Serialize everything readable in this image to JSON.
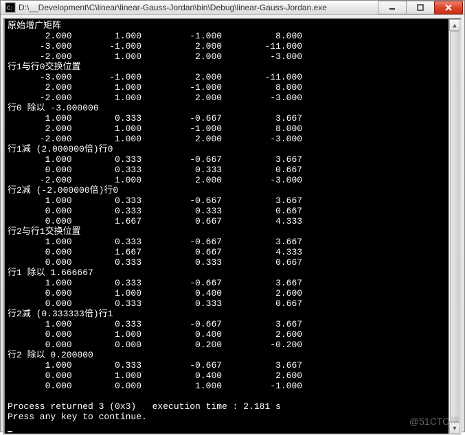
{
  "window": {
    "title": "D:\\__Development\\C\\linear\\linear-Gauss-Jordan\\bin\\Debug\\linear-Gauss-Jordan.exe"
  },
  "colors": {
    "close_red": "#d9472b",
    "console_bg": "#000000",
    "console_fg": "#ffffff"
  },
  "console": {
    "sections": [
      {
        "label": "原始增广矩阵",
        "rows": [
          [
            "2.000",
            "1.000",
            "-1.000",
            "8.000"
          ],
          [
            "-3.000",
            "-1.000",
            "2.000",
            "-11.000"
          ],
          [
            "-2.000",
            "1.000",
            "2.000",
            "-3.000"
          ]
        ]
      },
      {
        "label": "行1与行0交换位置",
        "rows": [
          [
            "-3.000",
            "-1.000",
            "2.000",
            "-11.000"
          ],
          [
            "2.000",
            "1.000",
            "-1.000",
            "8.000"
          ],
          [
            "-2.000",
            "1.000",
            "2.000",
            "-3.000"
          ]
        ]
      },
      {
        "label": "行0 除以 -3.000000",
        "rows": [
          [
            "1.000",
            "0.333",
            "-0.667",
            "3.667"
          ],
          [
            "2.000",
            "1.000",
            "-1.000",
            "8.000"
          ],
          [
            "-2.000",
            "1.000",
            "2.000",
            "-3.000"
          ]
        ]
      },
      {
        "label": "行1减 (2.000000倍)行0",
        "rows": [
          [
            "1.000",
            "0.333",
            "-0.667",
            "3.667"
          ],
          [
            "0.000",
            "0.333",
            "0.333",
            "0.667"
          ],
          [
            "-2.000",
            "1.000",
            "2.000",
            "-3.000"
          ]
        ]
      },
      {
        "label": "行2减 (-2.000000倍)行0",
        "rows": [
          [
            "1.000",
            "0.333",
            "-0.667",
            "3.667"
          ],
          [
            "0.000",
            "0.333",
            "0.333",
            "0.667"
          ],
          [
            "0.000",
            "1.667",
            "0.667",
            "4.333"
          ]
        ]
      },
      {
        "label": "行2与行1交换位置",
        "rows": [
          [
            "1.000",
            "0.333",
            "-0.667",
            "3.667"
          ],
          [
            "0.000",
            "1.667",
            "0.667",
            "4.333"
          ],
          [
            "0.000",
            "0.333",
            "0.333",
            "0.667"
          ]
        ]
      },
      {
        "label": "行1 除以 1.666667",
        "rows": [
          [
            "1.000",
            "0.333",
            "-0.667",
            "3.667"
          ],
          [
            "0.000",
            "1.000",
            "0.400",
            "2.600"
          ],
          [
            "0.000",
            "0.333",
            "0.333",
            "0.667"
          ]
        ]
      },
      {
        "label": "行2减 (0.333333倍)行1",
        "rows": [
          [
            "1.000",
            "0.333",
            "-0.667",
            "3.667"
          ],
          [
            "0.000",
            "1.000",
            "0.400",
            "2.600"
          ],
          [
            "0.000",
            "0.000",
            "0.200",
            "-0.200"
          ]
        ]
      },
      {
        "label": "行2 除以 0.200000",
        "rows": [
          [
            "1.000",
            "0.333",
            "-0.667",
            "3.667"
          ],
          [
            "0.000",
            "1.000",
            "0.400",
            "2.600"
          ],
          [
            "0.000",
            "0.000",
            "1.000",
            "-1.000"
          ]
        ]
      }
    ],
    "footer": [
      "Process returned 3 (0x3)   execution time : 2.181 s",
      "Press any key to continue."
    ]
  },
  "watermark": "@51CTO博"
}
